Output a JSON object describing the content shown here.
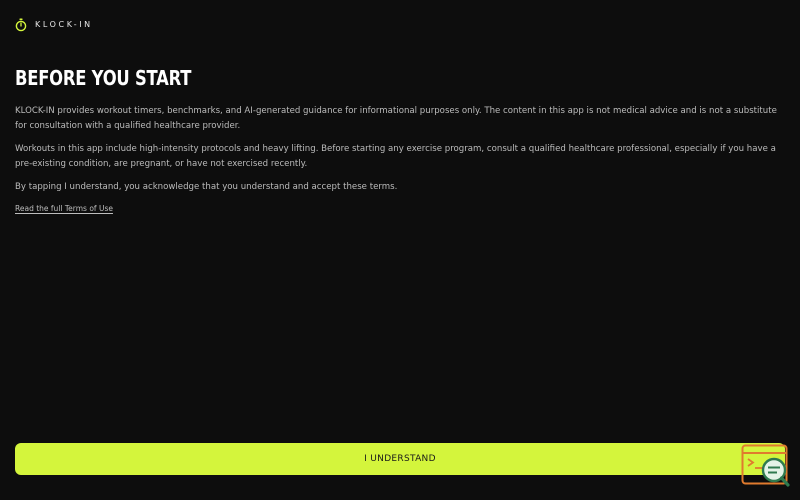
{
  "brand": {
    "name": "KLOCK-IN",
    "icon": "stopwatch-icon",
    "accent_color": "#d4f53c"
  },
  "page": {
    "title": "BEFORE YOU START",
    "paragraphs": [
      "KLOCK-IN provides workout timers, benchmarks, and AI-generated guidance for informational purposes only. The content in this app is not medical advice and is not a substitute for consultation with a qualified healthcare provider.",
      "Workouts in this app include high-intensity protocols and heavy lifting. Before starting any exercise program, consult a qualified healthcare professional, especially if you have a pre-existing condition, are pregnant, or have not exercised recently.",
      "By tapping I understand, you acknowledge that you understand and accept these terms."
    ],
    "terms_link": "Read the full Terms of Use"
  },
  "actions": {
    "understand_label": "I UNDERSTAND",
    "button_color": "#d4f53c"
  },
  "overlay": {
    "icon": "terminal-search-icon"
  }
}
